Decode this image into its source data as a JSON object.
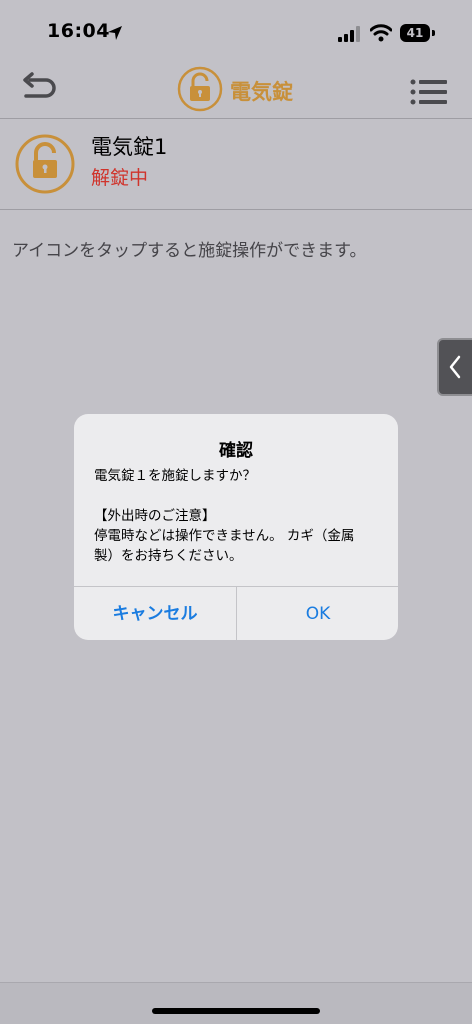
{
  "status_bar": {
    "time": "16:04",
    "battery": "41"
  },
  "nav": {
    "title": "電気錠",
    "icons": [
      "back-arrow-icon",
      "lock-icon",
      "menu-list-icon"
    ]
  },
  "device": {
    "name": "電気錠1",
    "status": "解錠中"
  },
  "hint": "アイコンをタップすると施錠操作ができます。",
  "alert": {
    "title": "確認",
    "message_lines": [
      "電気錠１を施錠しますか？",
      "",
      "【外出時のご注意】",
      "停電時などは操作できません。 カギ（金属",
      "製）をお持ちください。"
    ],
    "cancel_label": "キャンセル",
    "ok_label": "OK"
  },
  "colors": {
    "accent_gold": "#c8903a",
    "status_red": "#d0342c",
    "button_blue": "#1a7ce0"
  }
}
